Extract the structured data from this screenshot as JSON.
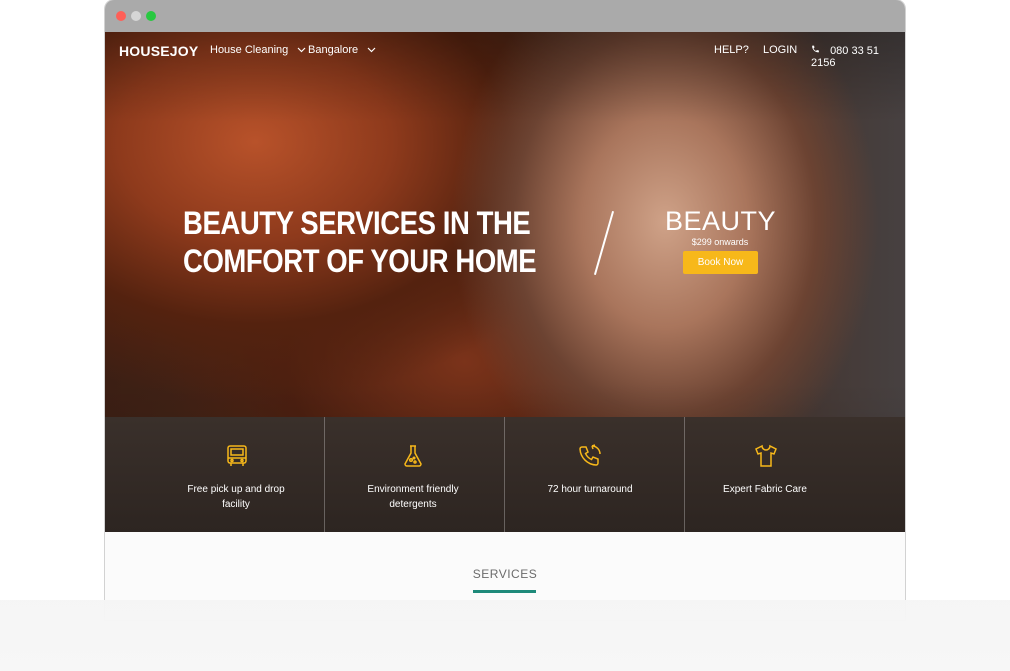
{
  "window": {
    "controls": [
      "close",
      "minimize",
      "maximize"
    ]
  },
  "nav": {
    "logo": "HOUSEJOY",
    "service_select": "House Cleaning",
    "city_select": "Bangalore",
    "help": "HELP?",
    "login": "LOGIN",
    "phone": "080 33 51 2156"
  },
  "hero": {
    "headline_line1": "BEAUTY SERVICES IN THE",
    "headline_line2": "COMFORT OF YOUR HOME",
    "promo_title": "BEAUTY",
    "promo_price": "$299 onwards",
    "book_button": "Book Now"
  },
  "features": [
    {
      "icon": "truck-icon",
      "label_line1": "Free pick up and drop",
      "label_line2": "facility"
    },
    {
      "icon": "flask-icon",
      "label_line1": "Environment friendly",
      "label_line2": "detergents"
    },
    {
      "icon": "phone-callback-icon",
      "label_line1": "72 hour turnaround",
      "label_line2": ""
    },
    {
      "icon": "shirt-icon",
      "label_line1": "Expert Fabric Care",
      "label_line2": ""
    }
  ],
  "services": {
    "title": "SERVICES"
  },
  "colors": {
    "accent_button": "#f7b81a",
    "feature_icon": "#f7b81a",
    "services_underline": "#1e8a7a"
  }
}
